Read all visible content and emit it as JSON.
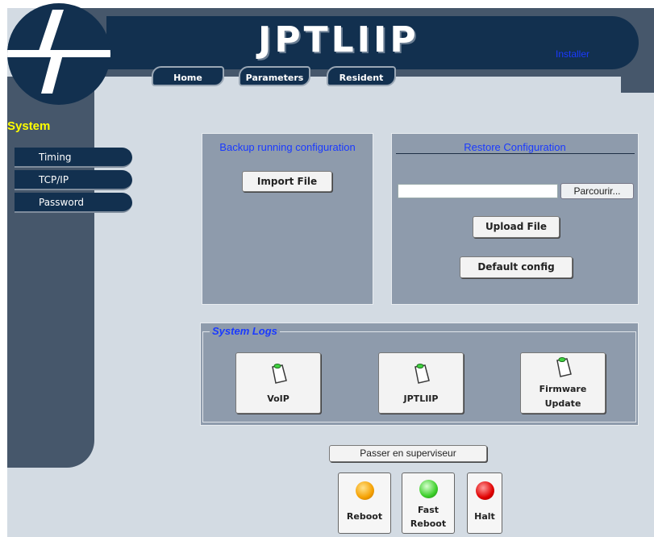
{
  "app": {
    "title": "JPTLIIP",
    "installer_link": "Installer"
  },
  "nav": {
    "tabs": [
      {
        "label": "Home"
      },
      {
        "label": "Parameters"
      },
      {
        "label": "Resident"
      }
    ]
  },
  "sidebar": {
    "section": "System",
    "items": [
      {
        "label": "Timing"
      },
      {
        "label": "TCP/IP"
      },
      {
        "label": "Password"
      }
    ]
  },
  "backup": {
    "title": "Backup running configuration",
    "import_button": "Import File"
  },
  "restore": {
    "title": "Restore Configuration",
    "file_value": "",
    "browse_button": "Parcourir...",
    "upload_button": "Upload File",
    "default_button": "Default config"
  },
  "logs": {
    "title": "System Logs",
    "items": [
      {
        "label": "VoIP",
        "icon": "clipboard-icon"
      },
      {
        "label": "JPTLIIP",
        "icon": "clipboard-icon"
      },
      {
        "label_line1": "Firmware",
        "label_line2": "Update",
        "icon": "clipboard-icon"
      }
    ]
  },
  "supervisor_button": "Passer en superviseur",
  "actions": [
    {
      "label": "Reboot",
      "color": "#f5a000"
    },
    {
      "label_line1": "Fast",
      "label_line2": "Reboot",
      "color": "#3ccf2a"
    },
    {
      "label": "Halt",
      "color": "#e00000"
    }
  ],
  "colors": {
    "header": "#12304f",
    "frame": "#46576b",
    "panel": "#8e9bac",
    "link": "#1a3aff",
    "section": "#ffff00"
  }
}
